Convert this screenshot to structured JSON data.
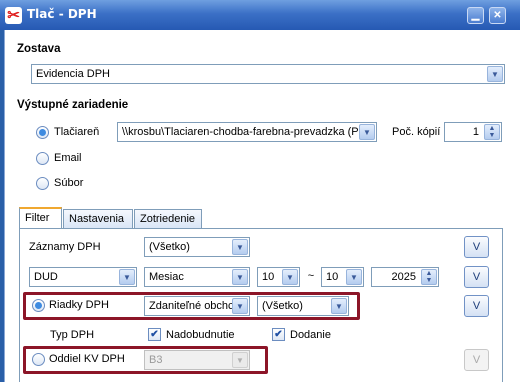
{
  "window": {
    "title": "Tlač - DPH",
    "minimize_glyph": "▁",
    "close_glyph": "✕",
    "app_icon": "scissors-icon"
  },
  "report": {
    "label": "Zostava",
    "selected": "Evidencia DPH"
  },
  "output": {
    "label": "Výstupné zariadenie",
    "printer_label": "Tlačiareň",
    "printer_value": "\\\\krosbu\\Tlaciaren-chodba-farebna-prevadzka (P",
    "copies_label": "Poč. kópií",
    "copies_value": "1",
    "email_label": "Email",
    "file_label": "Súbor"
  },
  "tabs": [
    {
      "label": "Filter"
    },
    {
      "label": "Nastavenia"
    },
    {
      "label": "Zotriedenie"
    }
  ],
  "filter": {
    "records_label": "Záznamy DPH",
    "records_value": "(Všetko)",
    "doc_type_value": "DUD",
    "period_value": "Mesiac",
    "from_value": "10",
    "range_sep": "~",
    "to_value": "10",
    "year_value": "2025",
    "rows_label": "Riadky DPH",
    "rows_value": "Zdaniteľné obchc",
    "rows_detail_value": "(Všetko)",
    "type_label": "Typ DPH",
    "acquisition_label": "Nadobudnutie",
    "supply_label": "Dodanie",
    "section_label": "Oddiel KV DPH",
    "section_value": "B3",
    "v_label": "V"
  },
  "colors": {
    "title_bar": "#2659b3",
    "highlight": "#8c1528",
    "tab_accent": "#f0a830"
  }
}
